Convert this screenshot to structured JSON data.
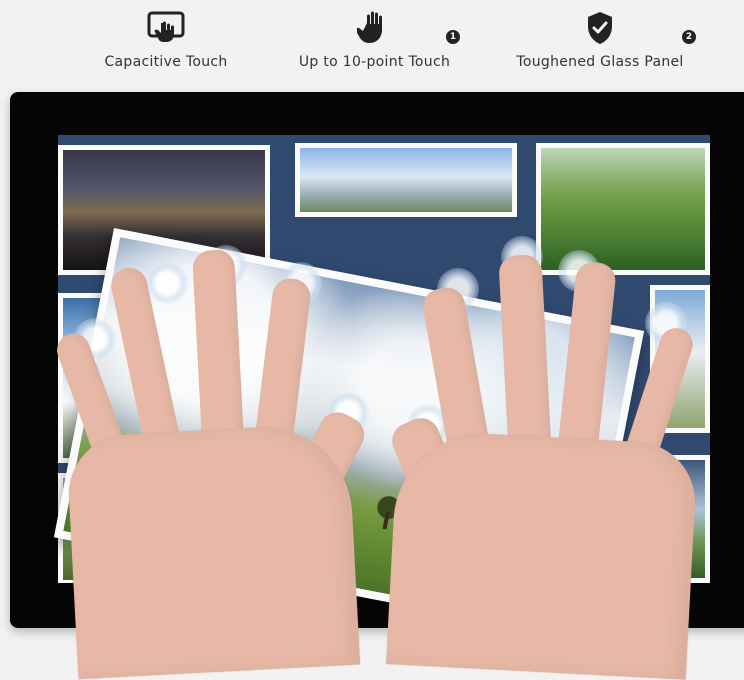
{
  "features": [
    {
      "label": "Capacitive Touch",
      "icon": "touch-screen-icon"
    },
    {
      "label": "Up to 10-point Touch",
      "icon": "hand-icon"
    },
    {
      "label": "Toughened Glass Panel",
      "icon": "shield-check-icon"
    }
  ],
  "badges": [
    "1",
    "2"
  ],
  "colors": {
    "background": "#f2f2f2",
    "text": "#333333",
    "device": "#050505",
    "screen": "#30496f",
    "skin": "#e7b8a6"
  }
}
